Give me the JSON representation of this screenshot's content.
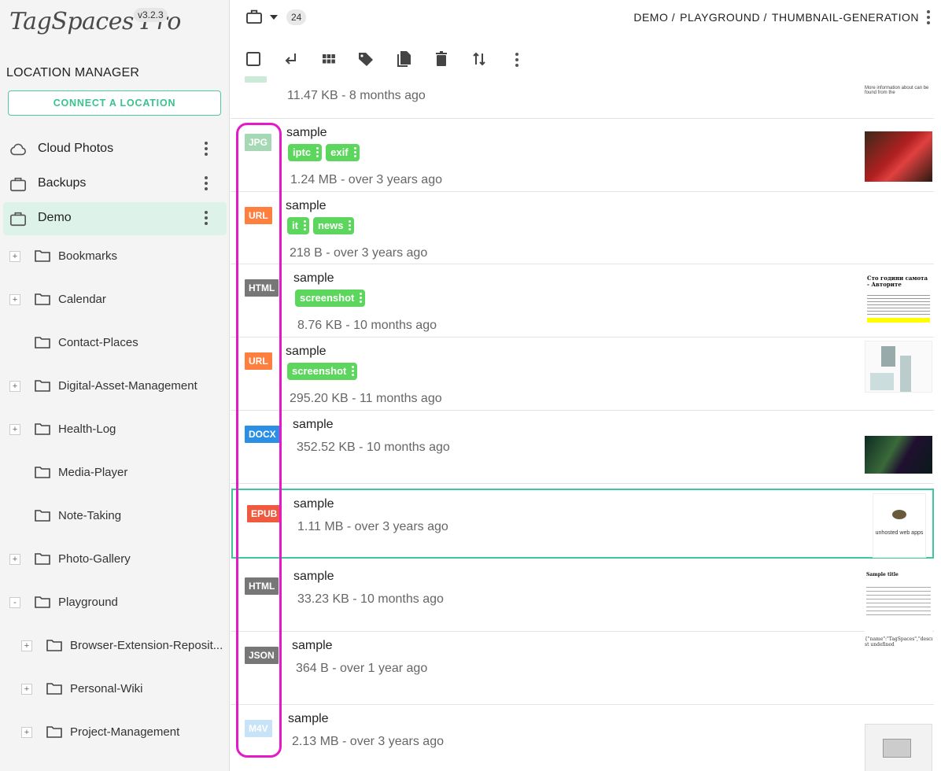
{
  "app": {
    "logo": "TagSpaces Pro",
    "version": "v3.2.3"
  },
  "sidebar": {
    "title": "LOCATION MANAGER",
    "connect_label": "CONNECT A LOCATION",
    "locations": [
      {
        "name": "Cloud Photos",
        "icon": "cloud-icon"
      },
      {
        "name": "Backups",
        "icon": "briefcase-icon"
      },
      {
        "name": "Demo",
        "icon": "briefcase-icon",
        "active": true
      }
    ],
    "tree": [
      {
        "name": "Bookmarks",
        "expander": "+"
      },
      {
        "name": "Calendar",
        "expander": "+"
      },
      {
        "name": "Contact-Places",
        "expander": ""
      },
      {
        "name": "Digital-Asset-Management",
        "expander": "+"
      },
      {
        "name": "Health-Log",
        "expander": "+"
      },
      {
        "name": "Media-Player",
        "expander": ""
      },
      {
        "name": "Note-Taking",
        "expander": ""
      },
      {
        "name": "Photo-Gallery",
        "expander": "+"
      },
      {
        "name": "Playground",
        "expander": "-"
      },
      {
        "name": "Browser-Extension-Reposit...",
        "expander": "+",
        "child": true
      },
      {
        "name": "Personal-Wiki",
        "expander": "+",
        "child": true
      },
      {
        "name": "Project-Management",
        "expander": "+",
        "child": true
      }
    ]
  },
  "topbar": {
    "count": "24",
    "breadcrumb": [
      "DEMO /",
      "PLAYGROUND /",
      "THUMBNAIL-GENERATION"
    ]
  },
  "toolbar": {
    "icons": [
      "select-all-checkbox-icon",
      "parent-folder-icon",
      "grid-view-icon",
      "tag-icon",
      "copy-icon",
      "delete-icon",
      "sort-icon",
      "more-icon"
    ]
  },
  "files": [
    {
      "name": "",
      "ext": "",
      "meta": "11.47 KB -  8 months ago",
      "tags": [],
      "partial": true
    },
    {
      "name": "sample",
      "ext": "JPG",
      "color": "#a6d8b6",
      "meta": "1.24 MB -  over 3 years ago",
      "tags": [
        "iptc",
        "exif"
      ],
      "thumb": "car"
    },
    {
      "name": "sample",
      "ext": "URL",
      "color": "#ff7f3f",
      "meta": "218 B -  over 3 years ago",
      "tags": [
        "it",
        "news"
      ],
      "thumb": "none"
    },
    {
      "name": "sample",
      "ext": "HTML",
      "color": "#777777",
      "meta": "8.76 KB -  10 months ago",
      "tags": [
        "screenshot"
      ],
      "thumb": "article"
    },
    {
      "name": "sample",
      "ext": "URL",
      "color": "#ff7f3f",
      "meta": "295.20 KB -  11 months ago",
      "tags": [
        "screenshot"
      ],
      "thumb": "web"
    },
    {
      "name": "sample",
      "ext": "DOCX",
      "color": "#2b8fe6",
      "meta": "352.52 KB -  10 months ago",
      "tags": [],
      "thumb": "dark"
    },
    {
      "name": "sample",
      "ext": "EPUB",
      "color": "#ef5a3f",
      "meta": "1.11 MB -  over 3 years ago",
      "tags": [],
      "thumb": "book",
      "selected": true
    },
    {
      "name": "sample",
      "ext": "HTML",
      "color": "#777777",
      "meta": "33.23 KB -  10 months ago",
      "tags": [],
      "thumb": "doc"
    },
    {
      "name": "sample",
      "ext": "JSON",
      "color": "#777777",
      "meta": "364 B -  over 1 year ago",
      "tags": [],
      "thumb": "json"
    },
    {
      "name": "sample",
      "ext": "M4V",
      "color": "#c7e3f7",
      "meta": "2.13 MB -  over 3 years ago",
      "tags": [],
      "thumb": "video"
    }
  ],
  "thumb_text": {
    "partial": "More information about can be found from the",
    "article_title": "Сто години самота - Авторите",
    "book": "unhosted web apps",
    "doc_title": "Sample title",
    "json": "{\"name\":\"TagSpaces\",\"description\":\"Offline st undefined"
  }
}
